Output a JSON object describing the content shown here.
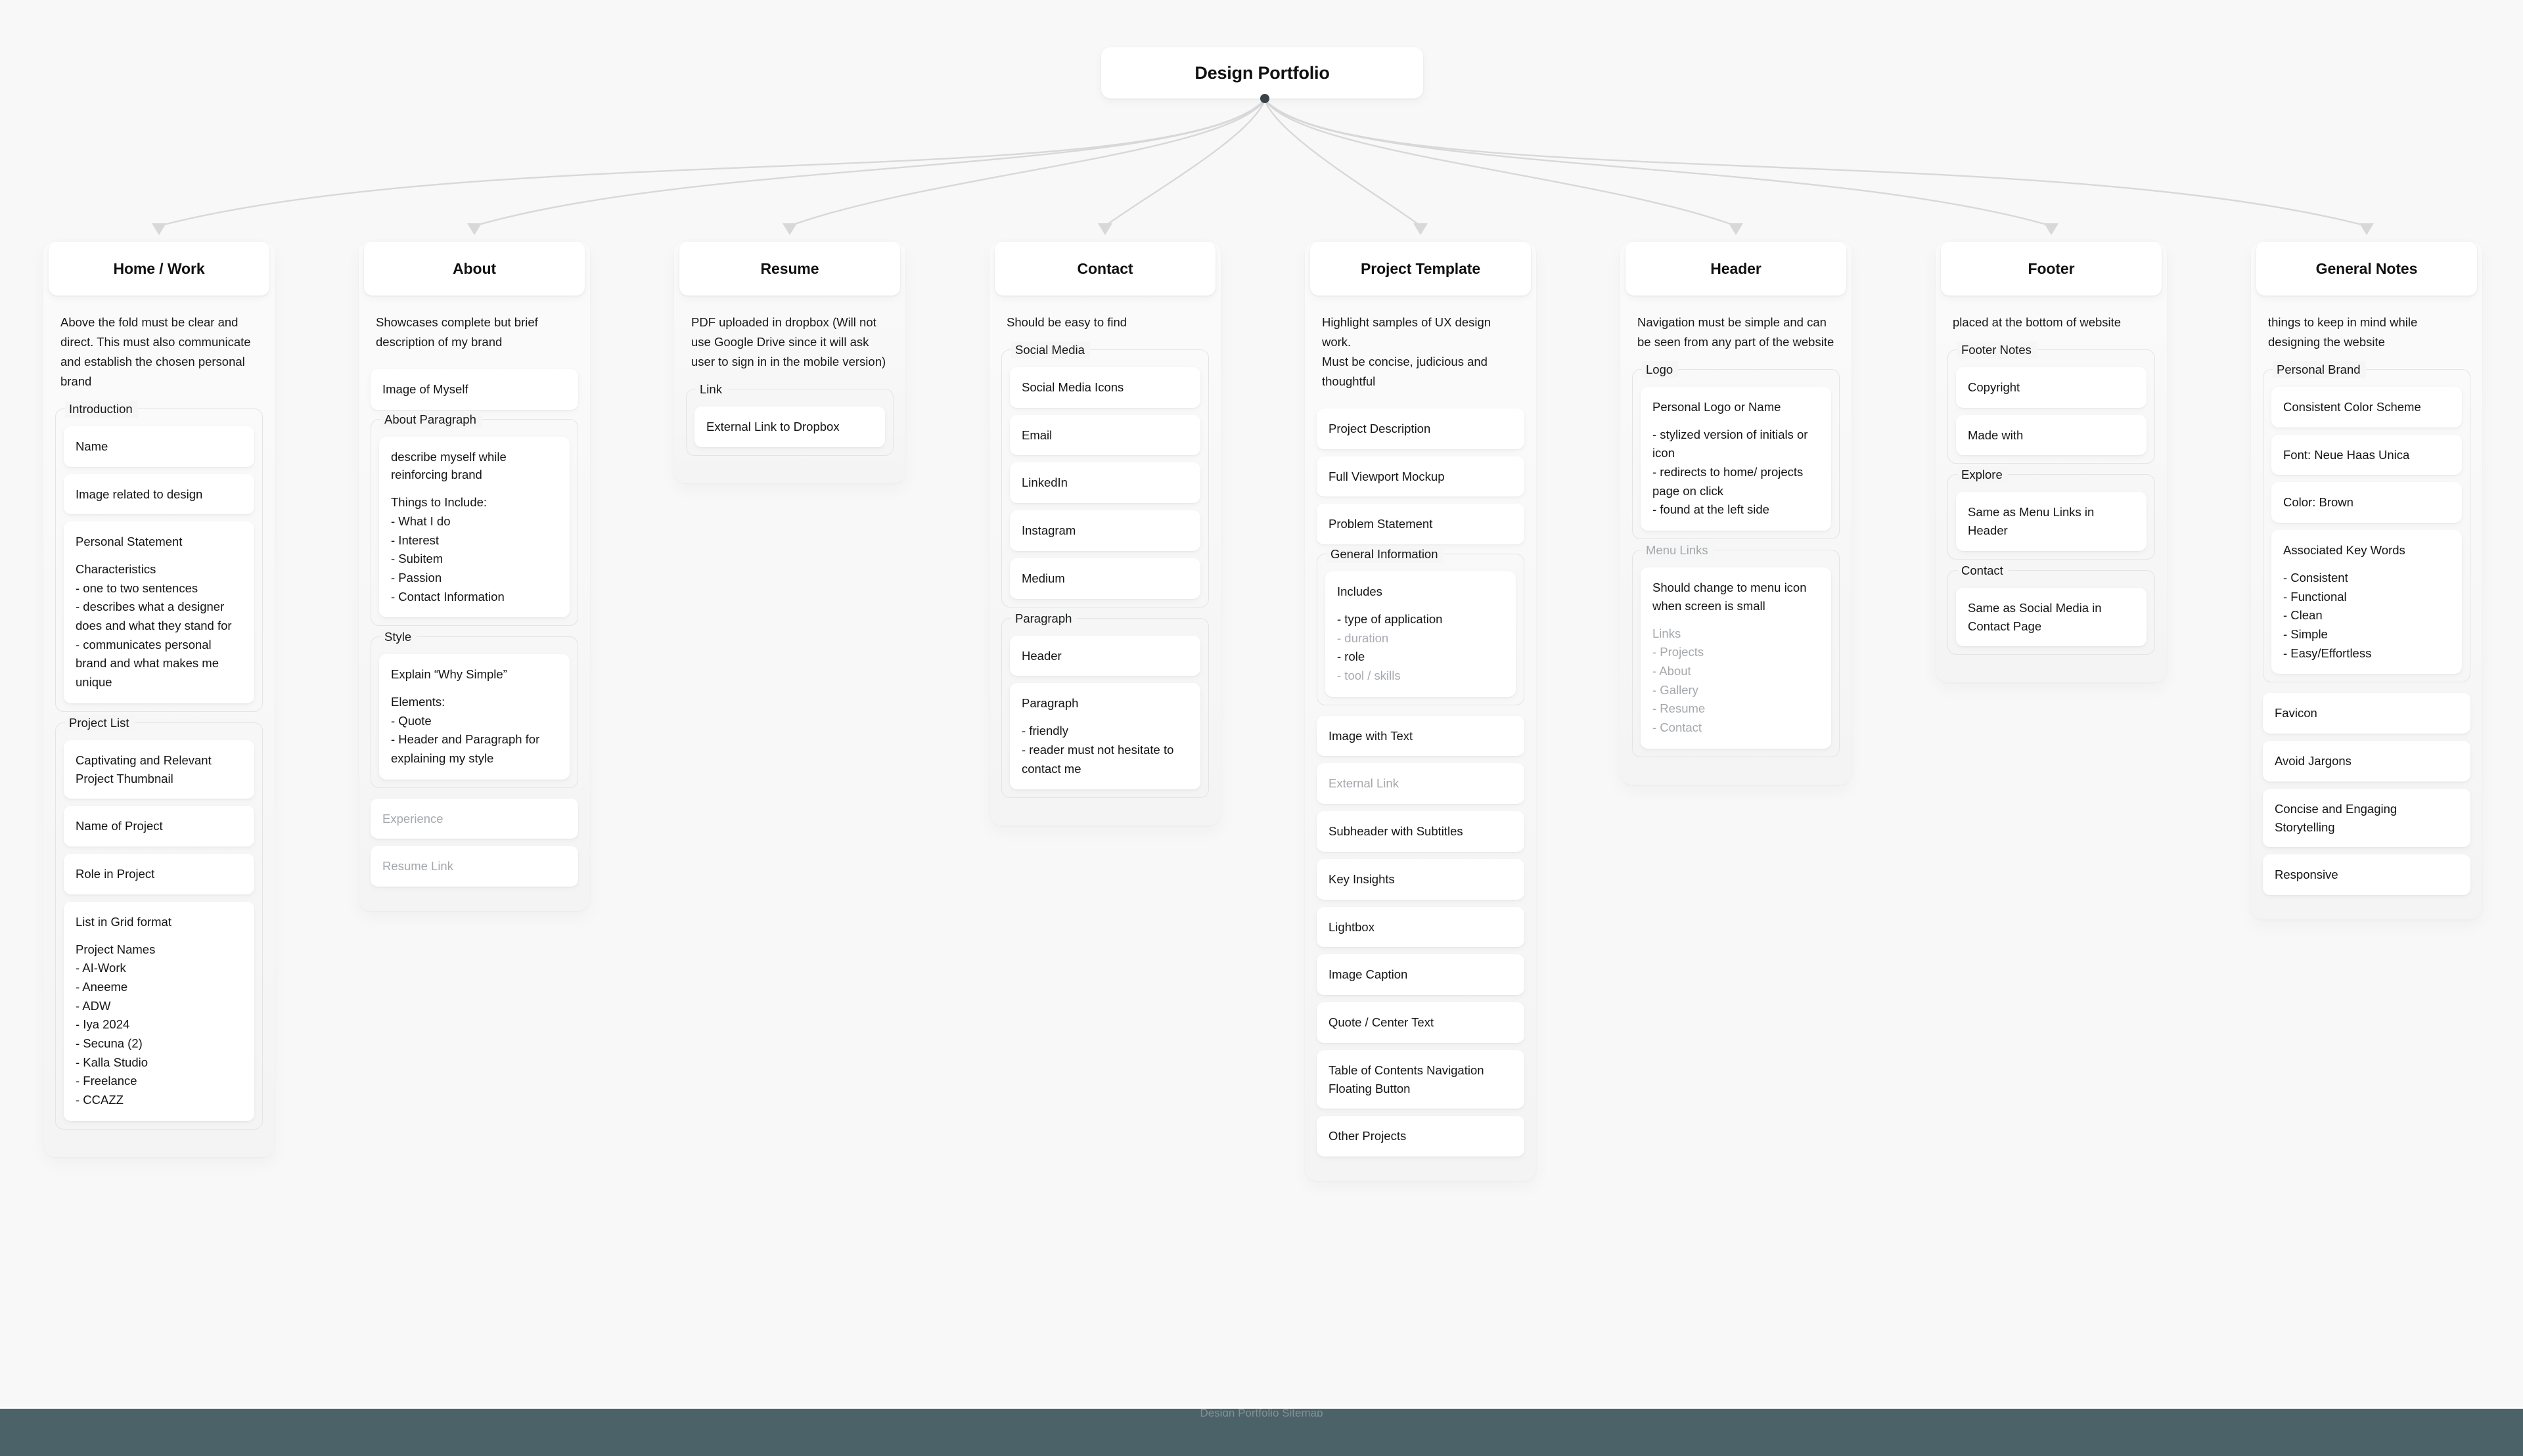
{
  "root": {
    "title": "Design Portfolio"
  },
  "colors": {
    "canvas_background": "#f8f8f8",
    "card_background": "#ffffff",
    "text": "#141516",
    "muted_text": "#a4a8ac",
    "edge_line": "#d8d8d8",
    "root_dot": "#3a4448",
    "bottom_bar": "#4b6268"
  },
  "bottom_bar": {
    "text": "Design Portfolio Sitemap"
  },
  "columns": [
    {
      "id": "home-work",
      "title": "Home / Work",
      "blurb": "Above the fold must be clear and direct. This must also communicate and establish the chosen personal brand",
      "blocks": [
        {
          "type": "group",
          "label": "Introduction",
          "items": [
            {
              "title": "Name"
            },
            {
              "title": "Image related to design"
            },
            {
              "title": "Personal Statement",
              "sub": "Characteristics\n- one to two sentences\n- describes what a designer does and what they stand for\n- communicates personal brand and what makes me unique"
            }
          ]
        },
        {
          "type": "group",
          "label": "Project List",
          "items": [
            {
              "title": "Captivating and Relevant Project Thumbnail"
            },
            {
              "title": "Name of Project"
            },
            {
              "title": "Role in Project"
            },
            {
              "title": "List in Grid format",
              "sub": "Project Names\n- AI-Work\n- Aneeme\n- ADW\n- Iya 2024\n- Secuna (2)\n- Kalla Studio\n- Freelance\n- CCAZZ"
            }
          ]
        }
      ]
    },
    {
      "id": "about",
      "title": "About",
      "blurb": "Showcases complete but brief description of my brand",
      "blocks": [
        {
          "type": "card",
          "title": "Image of Myself"
        },
        {
          "type": "group",
          "label": "About Paragraph",
          "items": [
            {
              "title": "describe myself while reinforcing brand",
              "sub": "Things to Include:\n- What I do\n- Interest\n- Subitem\n- Passion\n- Contact Information"
            }
          ]
        },
        {
          "type": "group",
          "label": "Style",
          "items": [
            {
              "title": "Explain “Why Simple”",
              "sub": "Elements:\n- Quote\n- Header and Paragraph for explaining my style"
            }
          ]
        },
        {
          "type": "card",
          "title": "Experience",
          "muted": true
        },
        {
          "type": "card",
          "title": "Resume Link",
          "muted": true
        }
      ]
    },
    {
      "id": "resume",
      "title": "Resume",
      "blurb": "PDF uploaded in dropbox (Will not use Google Drive since it will ask user to sign in in the mobile version)",
      "blocks": [
        {
          "type": "group",
          "label": "Link",
          "items": [
            {
              "title": "External Link to Dropbox"
            }
          ]
        }
      ]
    },
    {
      "id": "contact",
      "title": "Contact",
      "blurb": "Should be easy to find",
      "blocks": [
        {
          "type": "group",
          "label": "Social Media",
          "items": [
            {
              "title": "Social Media Icons"
            },
            {
              "title": "Email"
            },
            {
              "title": "LinkedIn"
            },
            {
              "title": "Instagram"
            },
            {
              "title": "Medium"
            }
          ]
        },
        {
          "type": "group",
          "label": "Paragraph",
          "items": [
            {
              "title": "Header"
            },
            {
              "title": "Paragraph",
              "sub": "- friendly\n- reader must not hesitate to contact me"
            }
          ]
        }
      ]
    },
    {
      "id": "project-template",
      "title": "Project Template",
      "blurb": "Highlight samples of UX design work.\nMust be concise, judicious and thoughtful",
      "blocks": [
        {
          "type": "card",
          "title": "Project Description"
        },
        {
          "type": "card",
          "title": "Full Viewport Mockup"
        },
        {
          "type": "card",
          "title": "Problem Statement"
        },
        {
          "type": "group",
          "label": "General Information",
          "items": [
            {
              "title": "Includes",
              "sub_parts": [
                {
                  "text": "- type of application",
                  "dim": false
                },
                {
                  "text": "- duration",
                  "dim": true
                },
                {
                  "text": "- role",
                  "dim": false
                },
                {
                  "text": "- tool / skills",
                  "dim": true
                }
              ]
            }
          ]
        },
        {
          "type": "card",
          "title": "Image with Text"
        },
        {
          "type": "card",
          "title": "External Link",
          "muted": true
        },
        {
          "type": "card",
          "title": "Subheader with Subtitles"
        },
        {
          "type": "card",
          "title": "Key Insights"
        },
        {
          "type": "card",
          "title": "Lightbox"
        },
        {
          "type": "card",
          "title": "Image Caption"
        },
        {
          "type": "card",
          "title": "Quote / Center Text"
        },
        {
          "type": "card",
          "title": "Table of Contents Navigation Floating Button"
        },
        {
          "type": "card",
          "title": "Other Projects"
        }
      ]
    },
    {
      "id": "header",
      "title": "Header",
      "blurb": "Navigation must be simple and can be seen from any part of the website",
      "blocks": [
        {
          "type": "group",
          "label": "Logo",
          "items": [
            {
              "title": "Personal Logo or Name",
              "sub": "- stylized version of initials or icon\n- redirects to home/ projects page on click\n- found at the left side"
            }
          ]
        },
        {
          "type": "group",
          "label": "Menu Links",
          "label_muted": true,
          "items": [
            {
              "title": "Should change to menu icon when screen is small",
              "sub": "Links\n- Projects\n- About\n- Gallery\n- Resume\n- Contact",
              "sub_muted": true
            }
          ]
        }
      ]
    },
    {
      "id": "footer",
      "title": "Footer",
      "blurb": "placed at the bottom of website",
      "blocks": [
        {
          "type": "group",
          "label": "Footer Notes",
          "items": [
            {
              "title": "Copyright"
            },
            {
              "title": "Made with"
            }
          ]
        },
        {
          "type": "group",
          "label": "Explore",
          "items": [
            {
              "title": "Same as Menu Links in Header"
            }
          ]
        },
        {
          "type": "group",
          "label": "Contact",
          "items": [
            {
              "title": "Same as Social Media in Contact Page"
            }
          ]
        }
      ]
    },
    {
      "id": "general-notes",
      "title": "General Notes",
      "blurb": "things to keep in mind while designing the website",
      "blocks": [
        {
          "type": "group",
          "label": "Personal Brand",
          "items": [
            {
              "title": "Consistent Color Scheme"
            },
            {
              "title": "Font: Neue Haas Unica"
            },
            {
              "title": "Color: Brown"
            },
            {
              "title": "Associated Key Words",
              "sub": "- Consistent\n- Functional\n- Clean\n- Simple\n- Easy/Effortless"
            }
          ]
        },
        {
          "type": "card",
          "title": "Favicon"
        },
        {
          "type": "card",
          "title": "Avoid Jargons"
        },
        {
          "type": "card",
          "title": "Concise and Engaging Storytelling"
        },
        {
          "type": "card",
          "title": "Responsive"
        }
      ]
    }
  ]
}
